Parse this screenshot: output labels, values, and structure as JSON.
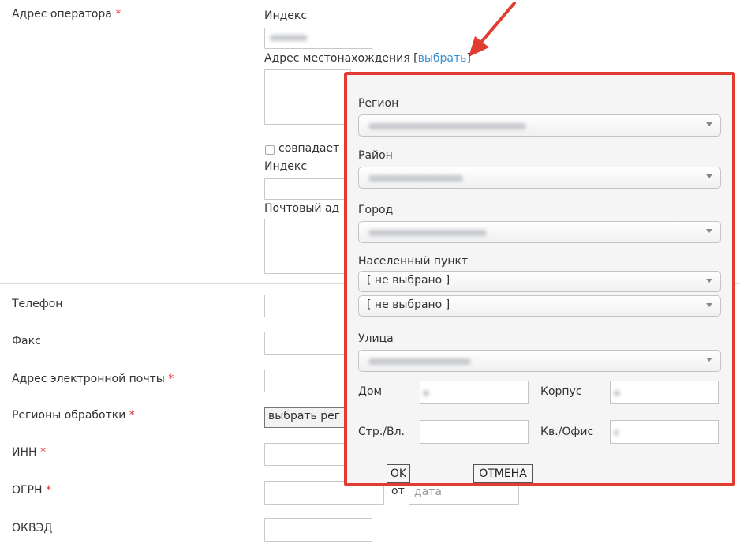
{
  "form": {
    "operator_address": {
      "label": "Адрес оператора",
      "required": "*"
    },
    "index_label": "Индекс",
    "location_address": {
      "label": "Адрес местонахождения [",
      "link": "выбрать",
      "suffix": "]"
    },
    "same_checkbox_label": "совпадает",
    "index2_label": "Индекс",
    "postal_address_label": "Почтовый ад",
    "phone_label": "Телефон",
    "fax_label": "Факс",
    "email": {
      "label": "Адрес электронной почты",
      "required": "*"
    },
    "regions": {
      "label": "Регионы обработки",
      "required": "*",
      "button": "выбрать рег"
    },
    "inn": {
      "label": "ИНН",
      "required": "*"
    },
    "ogrn": {
      "label": "ОГРН",
      "required": "*",
      "from_label": "от",
      "date_placeholder": "дата"
    },
    "okved_label": "ОКВЭД"
  },
  "modal": {
    "region_label": "Регион",
    "district_label": "Район",
    "city_label": "Город",
    "settlement_label": "Населенный пункт",
    "settlement_value": "[ не выбрано ]",
    "settlement2_value": "[ не выбрано ]",
    "street_label": "Улица",
    "house_label": "Дом",
    "building_label": "Корпус",
    "structure_label": "Стр./Вл.",
    "office_label": "Кв./Офис",
    "ok_button": "OK",
    "cancel_button": "ОТМЕНА"
  },
  "colors": {
    "accent_link": "#3a8fd0",
    "required": "#e0393e",
    "highlight_border": "#e03c31"
  }
}
